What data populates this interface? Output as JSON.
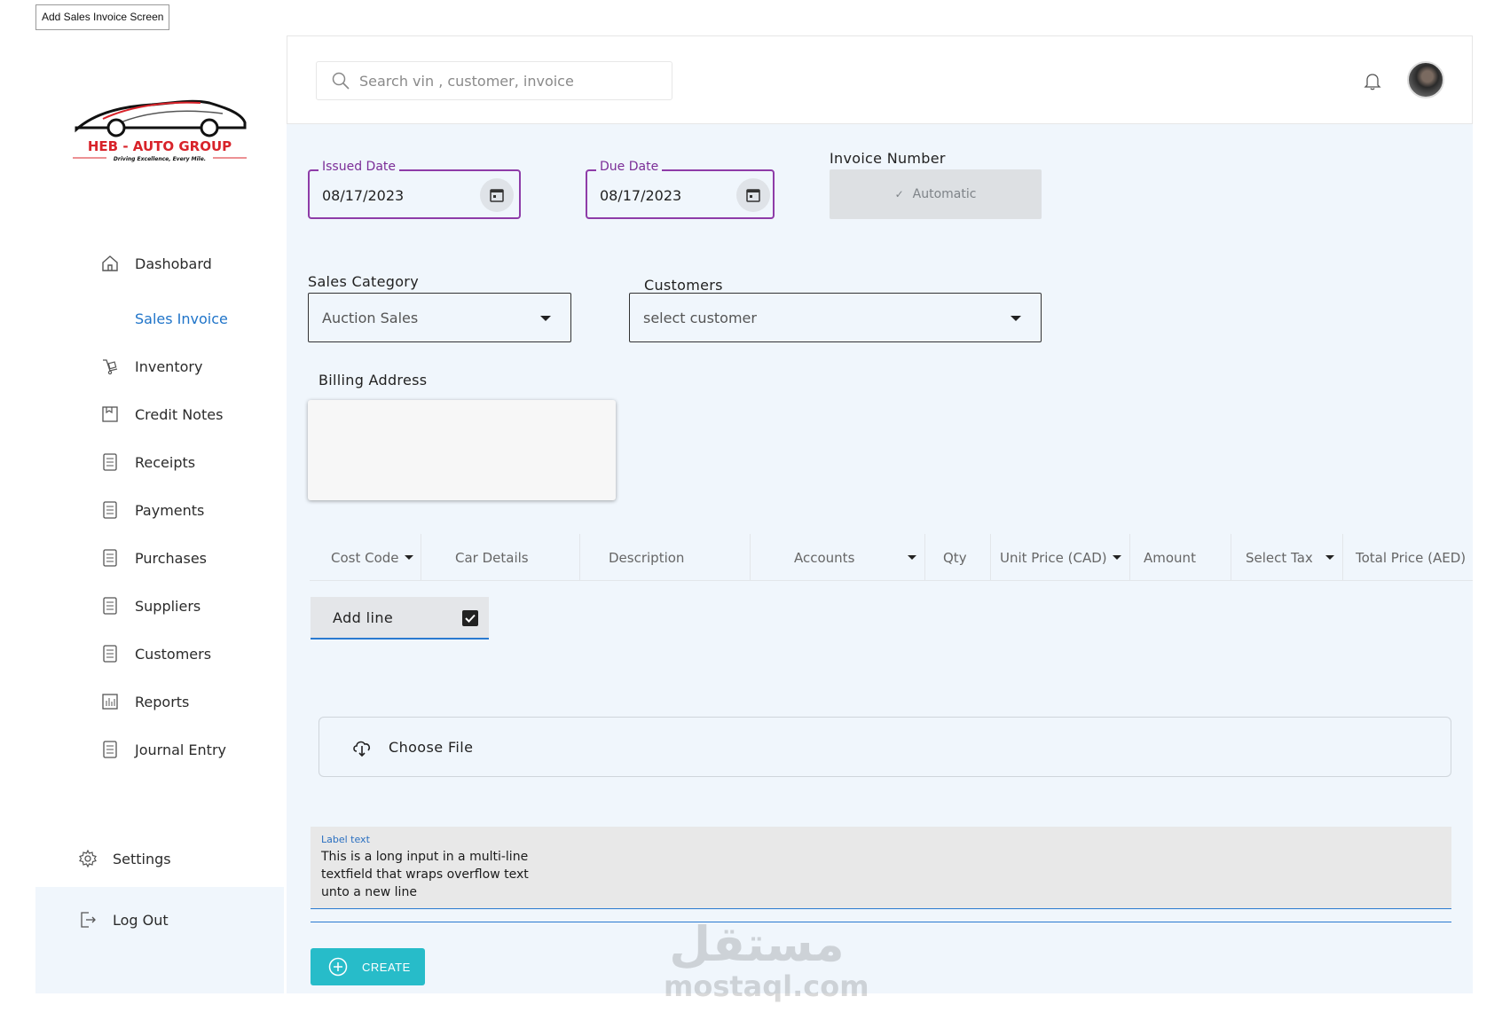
{
  "frame_label": "Add Sales Invoice Screen",
  "brand": {
    "name_left": "HEB",
    "dash": "-",
    "name_right": "AUTO GROUP",
    "tagline": "Driving Excellence, Every Mile.",
    "accent": "#d8232a"
  },
  "sidebar": {
    "items": [
      {
        "label": "Dashobard",
        "icon": "home-icon"
      },
      {
        "label": "Sales Invoice",
        "icon": ""
      },
      {
        "label": "Inventory",
        "icon": "inventory-icon"
      },
      {
        "label": "Credit Notes",
        "icon": "credit-notes-icon"
      },
      {
        "label": "Receipts",
        "icon": "list-document-icon"
      },
      {
        "label": "Payments",
        "icon": "list-document-icon"
      },
      {
        "label": "Purchases",
        "icon": "list-document-icon"
      },
      {
        "label": "Suppliers",
        "icon": "list-document-icon"
      },
      {
        "label": "Customers",
        "icon": "list-document-icon"
      },
      {
        "label": "Reports",
        "icon": "bar-chart-icon"
      },
      {
        "label": "Journal Entry",
        "icon": "list-document-icon"
      }
    ],
    "settings_label": "Settings",
    "logout_label": "Log Out",
    "active_color": "#1f74c9"
  },
  "header": {
    "search_placeholder": "Search vin , customer, invoice"
  },
  "form": {
    "issued_date_label": "Issued Date",
    "issued_date_value": "08/17/2023",
    "due_date_label": "Due Date",
    "due_date_value": "08/17/2023",
    "invoice_number_label": "Invoice Number",
    "invoice_number_value": "Automatic",
    "sales_category_label": "Sales Category",
    "sales_category_value": "Auction Sales",
    "customers_label": "Customers",
    "customers_value": "select customer",
    "billing_address_label": "Billing Address"
  },
  "table": {
    "columns": [
      "Cost Code",
      "Car Details",
      "Description",
      "Accounts",
      "Qty",
      "Unit Price (CAD)",
      "Amount",
      "Select Tax",
      "Total Price (AED)"
    ]
  },
  "add_line_label": "Add line",
  "choose_file_label": "Choose File",
  "notes": {
    "label": "Label text",
    "value": "This is a long input in a multi-line textfield that wraps overflow text unto a new line"
  },
  "create_label": "CREATE",
  "watermark": {
    "arabic": "مستقل",
    "latin": "mostaql.com"
  },
  "colors": {
    "date_border": "#8e3ca8",
    "primary_blue": "#2a7ad0",
    "create_button": "#27bcc9",
    "page_bg": "#f0f6fc"
  }
}
